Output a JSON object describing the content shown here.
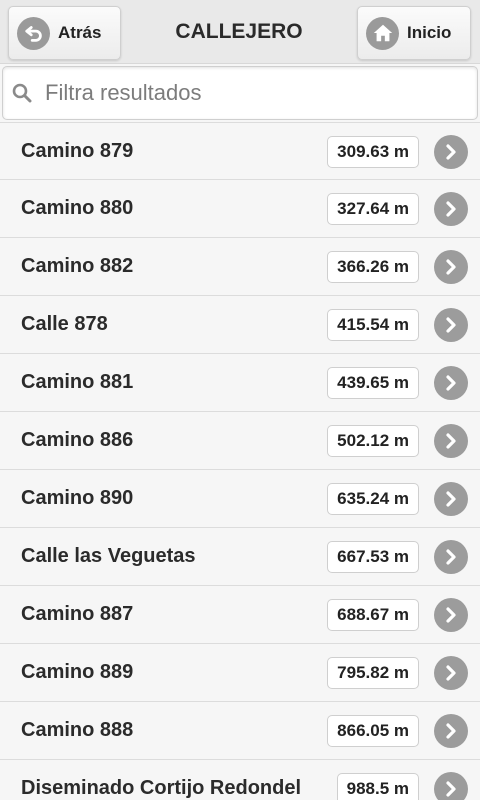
{
  "header": {
    "title": "CALLEJERO",
    "back_label": "Atrás",
    "home_label": "Inicio"
  },
  "search": {
    "placeholder": "Filtra resultados",
    "value": ""
  },
  "results": [
    {
      "name": "Camino 879",
      "distance": "309.63 m"
    },
    {
      "name": "Camino 880",
      "distance": "327.64 m"
    },
    {
      "name": "Camino 882",
      "distance": "366.26 m"
    },
    {
      "name": "Calle 878",
      "distance": "415.54 m"
    },
    {
      "name": "Camino 881",
      "distance": "439.65 m"
    },
    {
      "name": "Camino 886",
      "distance": "502.12 m"
    },
    {
      "name": "Camino 890",
      "distance": "635.24 m"
    },
    {
      "name": "Calle las Veguetas",
      "distance": "667.53 m"
    },
    {
      "name": "Camino 887",
      "distance": "688.67 m"
    },
    {
      "name": "Camino 889",
      "distance": "795.82 m"
    },
    {
      "name": "Camino 888",
      "distance": "866.05 m"
    },
    {
      "name": "Diseminado Cortijo Redondel",
      "distance": "988.5 m"
    }
  ],
  "icons": {
    "back": "back-arrow-icon",
    "home": "home-icon",
    "search": "search-icon",
    "row": "chevron-right-icon"
  }
}
